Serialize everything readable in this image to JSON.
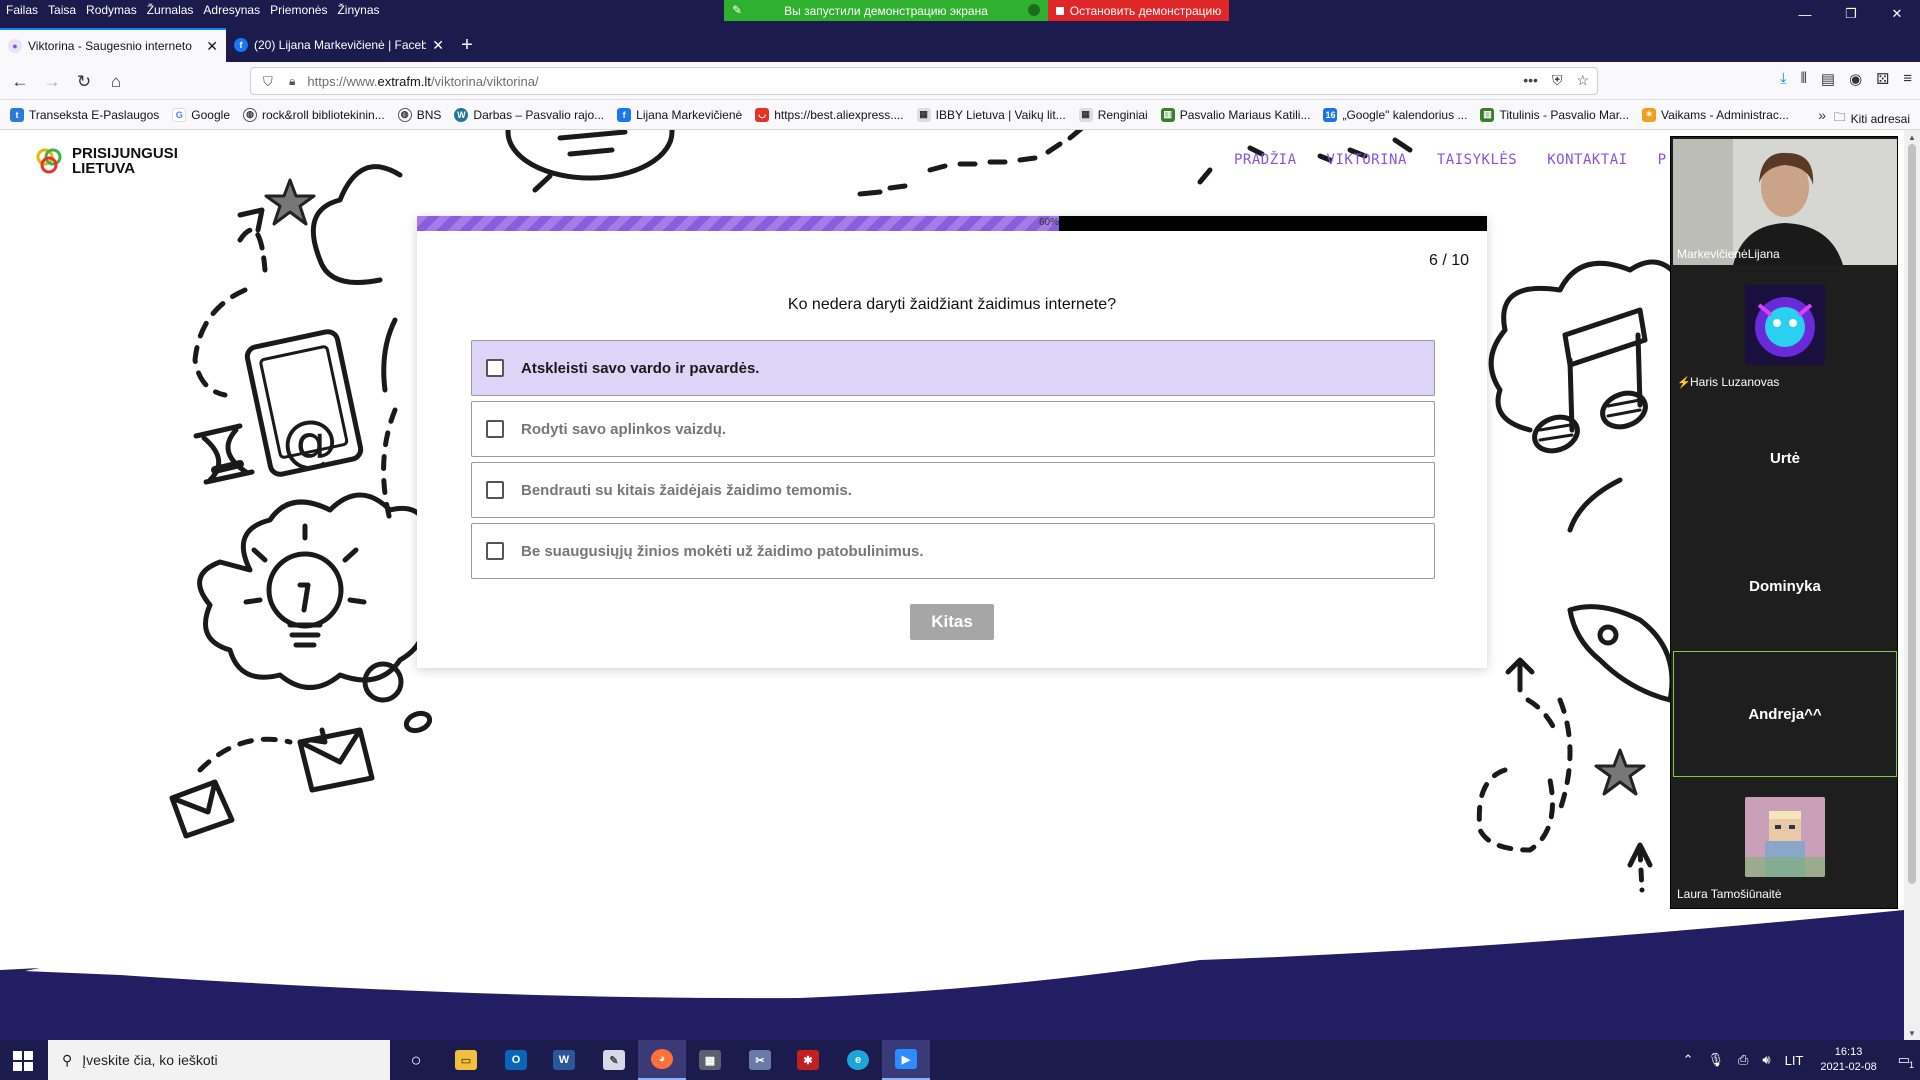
{
  "menubar": [
    "Failas",
    "Taisa",
    "Rodymas",
    "Žurnalas",
    "Adresynas",
    "Priemonės",
    "Žinynas"
  ],
  "screen_share": {
    "status": "Вы запустили демонстрацию экрана",
    "stop": "Остановить демонстрацию"
  },
  "tabs": [
    {
      "title": "Viktorina - Saugesnio interneto",
      "active": true
    },
    {
      "title": "(20) Lijana Markevičienė | Faceb",
      "active": false
    }
  ],
  "url": {
    "prefix": "https://www.",
    "domain": "extrafm.lt",
    "path": "/viktorina/viktorina/"
  },
  "bookmarks": [
    "Transeksta E-Paslaugos",
    "Google",
    "rock&roll bibliotekinin...",
    "BNS",
    "Darbas – Pasvalio rajo...",
    "Lijana Markevičienė",
    "https://best.aliexpress....",
    "IBBY Lietuva | Vaikų lit...",
    "Renginiai",
    "Pasvalio Mariaus Katili...",
    "„Google\" kalendorius ...",
    "Titulinis - Pasvalio Mar...",
    "Vaikams - Administrac..."
  ],
  "bookmarks_other": "Kiti adresai",
  "site": {
    "logo_line1": "PRISIJUNGUSI",
    "logo_line2": "LIETUVA",
    "nav": [
      "PRADŽIA",
      "VIKTORINA",
      "TAISYKLĖS",
      "KONTAKTAI",
      "P"
    ]
  },
  "quiz": {
    "progress_percent": 60,
    "progress_label": "60%",
    "counter": "6 / 10",
    "question": "Ko nedera daryti žaidžiant žaidimus internete?",
    "options": [
      {
        "text": "Atskleisti savo vardo ir pavardės.",
        "selected": true
      },
      {
        "text": "Rodyti savo aplinkos vaizdų.",
        "selected": false
      },
      {
        "text": "Bendrauti su kitais žaidėjais žaidimo temomis.",
        "selected": false
      },
      {
        "text": "Be suaugusiųjų žinios mokėti už žaidimo patobulinimus.",
        "selected": false
      }
    ],
    "next_label": "Kitas"
  },
  "participants": [
    {
      "name": "MarkevičienėLijana",
      "type": "video"
    },
    {
      "name": "Haris Luzanovas",
      "type": "avatar",
      "muted": true
    },
    {
      "name": "Urtė",
      "type": "name"
    },
    {
      "name": "Dominyka",
      "type": "name"
    },
    {
      "name": "Andreja^^",
      "type": "name",
      "active": true
    },
    {
      "name": "Laura Tamošiūnaitė",
      "type": "avatar"
    }
  ],
  "taskbar": {
    "search_placeholder": "Įveskite čia, ko ieškoti",
    "language": "LIT",
    "time": "16:13",
    "date": "2021-02-08",
    "notification_count": "1"
  },
  "colors": {
    "accent_purple": "#8a52e0",
    "option_selected_bg": "#ddd5f8",
    "chrome_dark": "#1b1b4e",
    "share_green": "#2fb12f",
    "share_red": "#e02727",
    "active_tile_border": "#7ad13a"
  }
}
